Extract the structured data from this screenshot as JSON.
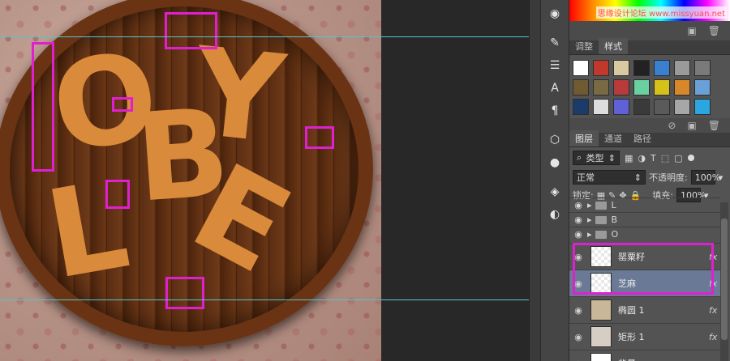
{
  "canvas": {
    "letters": [
      "O",
      "B",
      "Y",
      "L",
      "B",
      "E"
    ]
  },
  "watermark": "思缘设计论坛 www.missyuan.net",
  "adjust_tabs": [
    {
      "label": "调整",
      "active": false
    },
    {
      "label": "样式",
      "active": true
    }
  ],
  "style_colors": [
    "#ffffff",
    "#c0392b",
    "#d8c9a0",
    "#222222",
    "#3a7fd0",
    "#9a9a9a",
    "#7a7a7a",
    "#6f5a32",
    "#7a6a44",
    "#b83a3a",
    "#6ad0a0",
    "#d4c21a",
    "#d8882a",
    "#6aa0d8",
    "#1b3b6b",
    "#dddddd",
    "#6060d8",
    "#3a3a3a",
    "#5a5a5a",
    "#a7a7a7",
    "#2aa6e0"
  ],
  "layers_tabs": [
    {
      "label": "图层",
      "active": true
    },
    {
      "label": "通道",
      "active": false
    },
    {
      "label": "路径",
      "active": false
    }
  ],
  "filter": {
    "label": "类型"
  },
  "blend": {
    "mode": "正常",
    "opacity_label": "不透明度:",
    "opacity": "100%"
  },
  "lock": {
    "label": "锁定:",
    "fill_label": "填充:",
    "fill": "100%"
  },
  "groups": [
    {
      "name": "L"
    },
    {
      "name": "B"
    },
    {
      "name": "O"
    }
  ],
  "layers": [
    {
      "name": "罂粟籽",
      "fx": "fx",
      "selected": false
    },
    {
      "name": "芝麻",
      "fx": "fx",
      "selected": true
    },
    {
      "name": "椭圆 1",
      "fx": "fx",
      "selected": false
    },
    {
      "name": "矩形 1",
      "fx": "fx",
      "selected": false
    },
    {
      "name": "背景",
      "fx": "",
      "selected": false
    }
  ]
}
